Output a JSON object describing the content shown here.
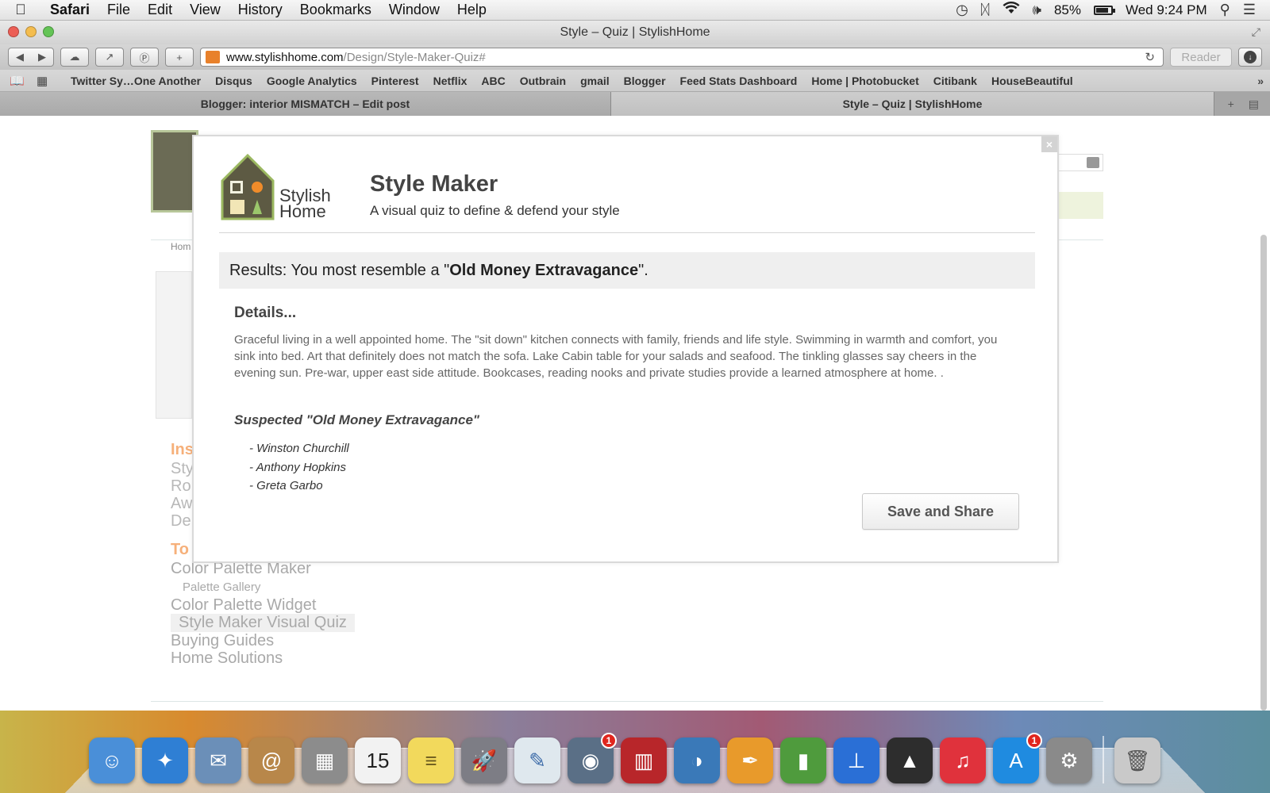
{
  "menubar": {
    "app": "Safari",
    "items": [
      "File",
      "Edit",
      "View",
      "History",
      "Bookmarks",
      "Window",
      "Help"
    ],
    "battery_label": "85%",
    "battery_level": 0.85,
    "clock": "Wed 9:24 PM",
    "status_icons": [
      "time-machine-icon",
      "bluetooth-icon",
      "wifi-icon",
      "volume-icon"
    ]
  },
  "window": {
    "title": "Style – Quiz | StylishHome"
  },
  "toolbar": {
    "url_host": "www.stylishhome.com",
    "url_path": "/Design/Style-Maker-Quiz#",
    "reader_label": "Reader"
  },
  "bookmarks": [
    "Twitter Sy…One Another",
    "Disqus",
    "Google Analytics",
    "Pinterest",
    "Netflix",
    "ABC",
    "Outbrain",
    "gmail",
    "Blogger",
    "Feed Stats Dashboard",
    "Home | Photobucket",
    "Citibank",
    "HouseBeautiful"
  ],
  "tabs": [
    {
      "label": "Blogger: interior MISMATCH – Edit post",
      "active": false
    },
    {
      "label": "Style – Quiz | StylishHome",
      "active": true
    }
  ],
  "background_page": {
    "breadcrumb": "Hom",
    "section1_title": "Ins",
    "section1_items": [
      "Sty",
      "Ro",
      "Aw",
      "De"
    ],
    "section2_title": "To",
    "nav": [
      {
        "label": "Color Palette Maker",
        "type": "item"
      },
      {
        "label": "Palette Gallery",
        "type": "sub"
      },
      {
        "label": "Color Palette Widget",
        "type": "item"
      },
      {
        "label": "Style Maker Visual Quiz",
        "type": "current"
      },
      {
        "label": "Buying Guides",
        "type": "item"
      },
      {
        "label": "Home Solutions",
        "type": "item"
      }
    ]
  },
  "modal": {
    "close_glyph": "×",
    "logo_text_line1": "Stylish",
    "logo_text_line2": "Home",
    "title": "Style Maker",
    "subtitle": "A visual quiz to define & defend your style",
    "results_prefix": "Results: You most resemble a \"",
    "results_style": "Old Money Extravagance",
    "results_suffix": "\".",
    "details_heading": "Details...",
    "details_text": "Graceful living in a well appointed home. The \"sit down\" kitchen connects with family, friends and life style. Swimming in warmth and comfort, you sink into bed. Art that definitely does not match the sofa. Lake Cabin table for your salads and seafood. The tinkling glasses say cheers in the evening sun. Pre-war, upper east side attitude. Bookcases, reading nooks and private studies provide a learned atmosphere at home. .",
    "suspected_heading": "Suspected \"Old Money Extravagance\"",
    "suspects": [
      "- Winston Churchill",
      "- Anthony Hopkins",
      "- Greta Garbo"
    ],
    "save_button": "Save and Share"
  },
  "dock": {
    "apps": [
      {
        "name": "finder-icon",
        "color": "#4a8fd8",
        "glyph": "☺"
      },
      {
        "name": "safari-icon",
        "color": "#2f7fd4",
        "glyph": "✦"
      },
      {
        "name": "mail-icon",
        "color": "#6b8fb8",
        "glyph": "✉"
      },
      {
        "name": "contacts-icon",
        "color": "#b8874a",
        "glyph": "@"
      },
      {
        "name": "calculator-icon",
        "color": "#8c8c8c",
        "glyph": "▦"
      },
      {
        "name": "calendar-icon",
        "color": "#f2f2f2",
        "glyph": "15",
        "text_color": "#222"
      },
      {
        "name": "notes-icon",
        "color": "#f2d95c",
        "glyph": "≡",
        "text_color": "#6b5a1e"
      },
      {
        "name": "launchpad-icon",
        "color": "#7d7d85",
        "glyph": "🚀"
      },
      {
        "name": "preview-icon",
        "color": "#dfe8ee",
        "glyph": "✎",
        "text_color": "#3b6aa8"
      },
      {
        "name": "facetime-icon",
        "color": "#5a6f86",
        "glyph": "◉",
        "badge": "1"
      },
      {
        "name": "photo-booth-icon",
        "color": "#b8262a",
        "glyph": "▥"
      },
      {
        "name": "iphoto-icon",
        "color": "#3a79b8",
        "glyph": "◑"
      },
      {
        "name": "pages-icon",
        "color": "#e89a2b",
        "glyph": "✒"
      },
      {
        "name": "numbers-icon",
        "color": "#4f9b3d",
        "glyph": "▮"
      },
      {
        "name": "keynote-icon",
        "color": "#2a6fd6",
        "glyph": "⊥"
      },
      {
        "name": "inkscape-icon",
        "color": "#2d2d2d",
        "glyph": "▲"
      },
      {
        "name": "itunes-icon",
        "color": "#e0323c",
        "glyph": "♫"
      },
      {
        "name": "app-store-icon",
        "color": "#1f8be0",
        "glyph": "A",
        "badge": "1"
      },
      {
        "name": "system-preferences-icon",
        "color": "#8a8a8a",
        "glyph": "⚙"
      },
      {
        "name": "trash-icon",
        "color": "#c9c9c9",
        "glyph": "🗑",
        "text_color": "#555"
      }
    ]
  }
}
